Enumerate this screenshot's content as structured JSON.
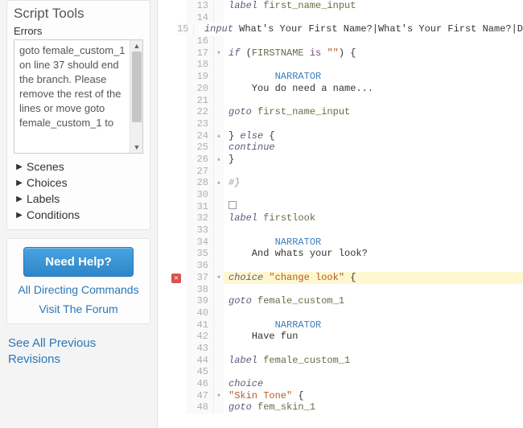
{
  "sidebar": {
    "title": "Script Tools",
    "errors_label": "Errors",
    "error_text": "goto female_custom_1 on line 37 should end the branch. Please remove the rest of the lines or move goto female_custom_1 to",
    "tree": [
      {
        "label": "Scenes"
      },
      {
        "label": "Choices"
      },
      {
        "label": "Labels"
      },
      {
        "label": "Conditions"
      }
    ],
    "help_button": "Need Help?",
    "help_links": [
      "All Directing Commands",
      "Visit The Forum"
    ],
    "revisions_link": "See All Previous Revisions"
  },
  "editor": {
    "error_line": 37,
    "lines": [
      {
        "n": 13,
        "fold": "",
        "spans": [
          [
            "kw-cmd",
            "label"
          ],
          [
            "",
            " "
          ],
          [
            "name",
            "first_name_input"
          ]
        ]
      },
      {
        "n": 14,
        "fold": "",
        "spans": []
      },
      {
        "n": 15,
        "fold": "",
        "spans": [
          [
            "kw-cmd",
            "input"
          ],
          [
            "",
            " What's Your First Name?|What's Your First Name?|D"
          ]
        ]
      },
      {
        "n": 16,
        "fold": "",
        "spans": []
      },
      {
        "n": 17,
        "fold": "▾",
        "spans": [
          [
            "kw-cmd",
            "if"
          ],
          [
            "",
            " ("
          ],
          [
            "name",
            "FIRSTNAME"
          ],
          [
            "",
            " "
          ],
          [
            "op",
            "is"
          ],
          [
            "",
            " "
          ],
          [
            "str",
            "\"\""
          ],
          [
            "",
            ") {"
          ]
        ]
      },
      {
        "n": 18,
        "fold": "",
        "spans": []
      },
      {
        "n": 19,
        "fold": "",
        "spans": [
          [
            "",
            "        "
          ],
          [
            "char",
            "NARRATOR"
          ]
        ]
      },
      {
        "n": 20,
        "fold": "",
        "spans": [
          [
            "",
            "    You do need a name..."
          ]
        ]
      },
      {
        "n": 21,
        "fold": "",
        "spans": []
      },
      {
        "n": 22,
        "fold": "",
        "spans": [
          [
            "kw-goto",
            "goto"
          ],
          [
            "",
            " "
          ],
          [
            "name",
            "first_name_input"
          ]
        ]
      },
      {
        "n": 23,
        "fold": "",
        "spans": []
      },
      {
        "n": 24,
        "fold": "▴",
        "spans": [
          [
            "",
            "} "
          ],
          [
            "kw-cmd",
            "else"
          ],
          [
            "",
            " {"
          ]
        ]
      },
      {
        "n": 25,
        "fold": "",
        "spans": [
          [
            "kw-cmd",
            "continue"
          ]
        ]
      },
      {
        "n": 26,
        "fold": "▴",
        "spans": [
          [
            "",
            "}"
          ]
        ]
      },
      {
        "n": 27,
        "fold": "",
        "spans": []
      },
      {
        "n": 28,
        "fold": "▴",
        "spans": [
          [
            "comment",
            "#}"
          ]
        ]
      },
      {
        "n": 30,
        "fold": "",
        "spans": []
      },
      {
        "n": 31,
        "fold": "",
        "spans": [],
        "checkbox": true
      },
      {
        "n": 32,
        "fold": "",
        "spans": [
          [
            "kw-cmd",
            "label"
          ],
          [
            "",
            " "
          ],
          [
            "name",
            "firstlook"
          ]
        ]
      },
      {
        "n": 33,
        "fold": "",
        "spans": []
      },
      {
        "n": 34,
        "fold": "",
        "spans": [
          [
            "",
            "        "
          ],
          [
            "char",
            "NARRATOR"
          ]
        ]
      },
      {
        "n": 35,
        "fold": "",
        "spans": [
          [
            "",
            "    And whats your look?"
          ]
        ]
      },
      {
        "n": 36,
        "fold": "",
        "spans": []
      },
      {
        "n": 37,
        "fold": "▾",
        "spans": [
          [
            "kw-cmd",
            "choice"
          ],
          [
            "",
            " "
          ],
          [
            "str",
            "\"change look\""
          ],
          [
            "",
            " {"
          ]
        ],
        "highlight": true,
        "error": true
      },
      {
        "n": 38,
        "fold": "",
        "spans": []
      },
      {
        "n": 39,
        "fold": "",
        "spans": [
          [
            "kw-goto",
            "goto"
          ],
          [
            "",
            " "
          ],
          [
            "name",
            "female_custom_1"
          ]
        ]
      },
      {
        "n": 40,
        "fold": "",
        "spans": []
      },
      {
        "n": 41,
        "fold": "",
        "spans": [
          [
            "",
            "        "
          ],
          [
            "char",
            "NARRATOR"
          ]
        ]
      },
      {
        "n": 42,
        "fold": "",
        "spans": [
          [
            "",
            "    Have fun"
          ]
        ]
      },
      {
        "n": 43,
        "fold": "",
        "spans": []
      },
      {
        "n": 44,
        "fold": "",
        "spans": [
          [
            "kw-cmd",
            "label"
          ],
          [
            "",
            " "
          ],
          [
            "name",
            "female_custom_1"
          ]
        ]
      },
      {
        "n": 45,
        "fold": "",
        "spans": []
      },
      {
        "n": 46,
        "fold": "",
        "spans": [
          [
            "kw-cmd",
            "choice"
          ]
        ]
      },
      {
        "n": 47,
        "fold": "▾",
        "spans": [
          [
            "str",
            "\"Skin Tone\""
          ],
          [
            "",
            " {"
          ]
        ]
      },
      {
        "n": 48,
        "fold": "",
        "spans": [
          [
            "kw-goto",
            "goto"
          ],
          [
            "",
            " "
          ],
          [
            "name",
            "fem_skin_1"
          ]
        ]
      }
    ]
  }
}
